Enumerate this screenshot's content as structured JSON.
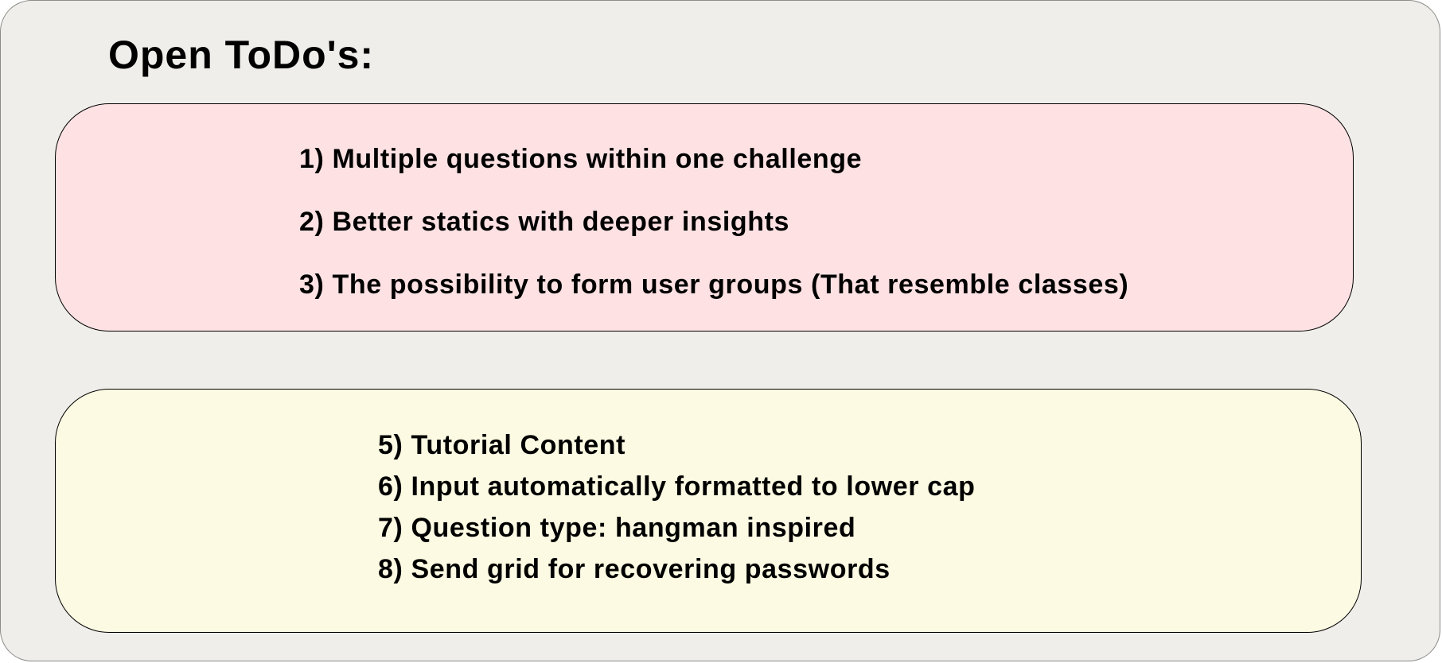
{
  "title": "Open ToDo's:",
  "colors": {
    "background": "#efeeea",
    "panel_pink": "#fde1e3",
    "panel_yellow": "#fcfae2",
    "text": "#000000"
  },
  "panels": [
    {
      "items": [
        "1) Multiple questions within one challenge",
        "2) Better statics with deeper insights",
        "3) The possibility to form user groups (That resemble classes)"
      ]
    },
    {
      "items": [
        "5) Tutorial Content",
        "6) Input automatically formatted to lower cap",
        "7) Question type: hangman inspired",
        "8) Send grid for recovering passwords"
      ]
    }
  ]
}
